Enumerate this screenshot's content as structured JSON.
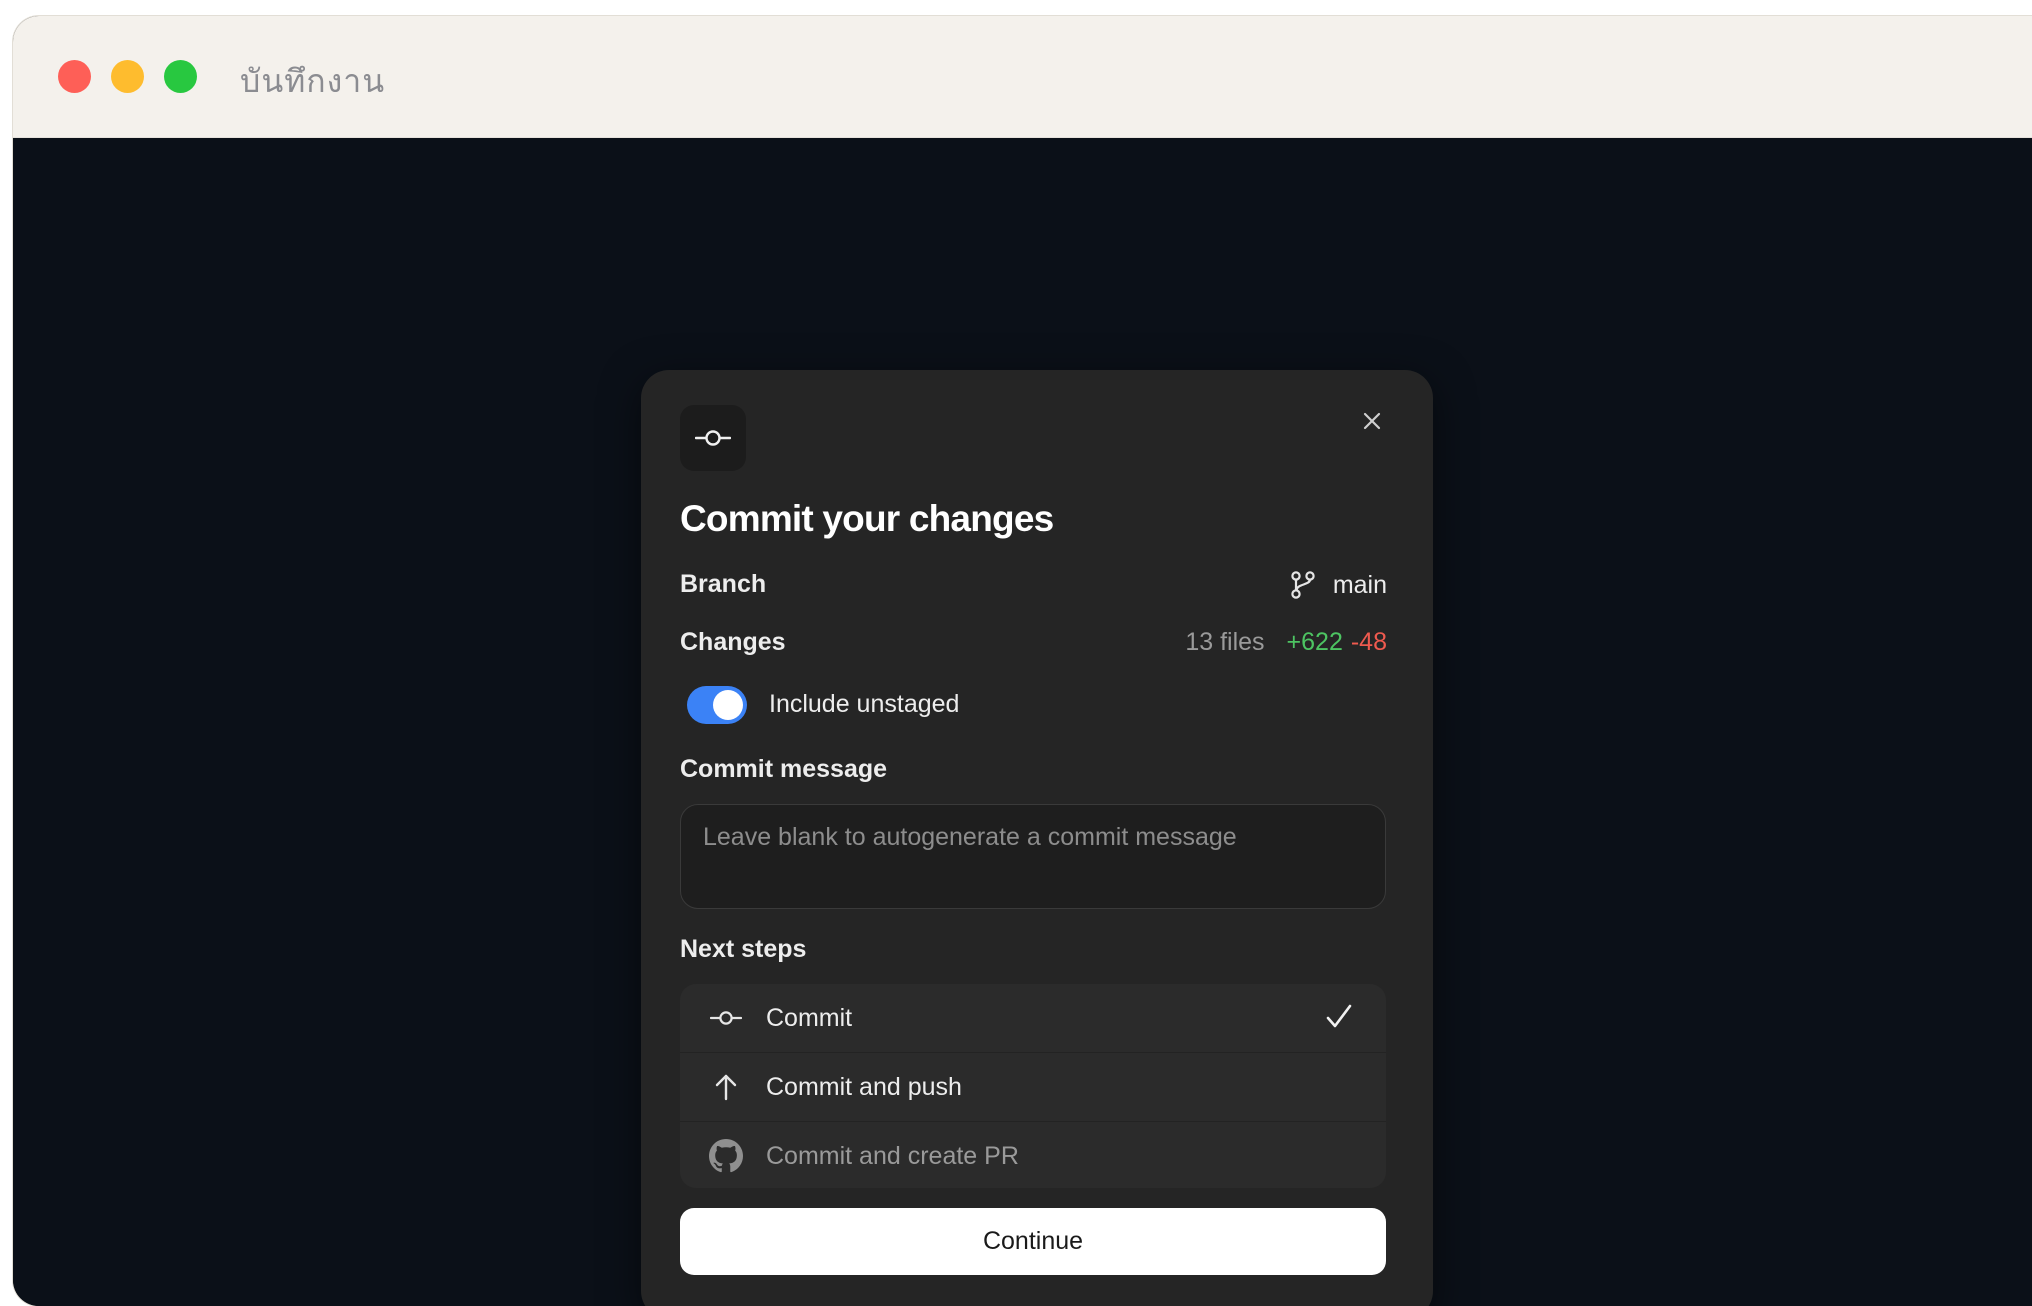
{
  "window": {
    "title": "บันทึกงาน"
  },
  "dialog": {
    "title": "Commit your changes",
    "branch": {
      "label": "Branch",
      "value": "main"
    },
    "changes": {
      "label": "Changes",
      "files": "13 files",
      "additions": "+622",
      "deletions": "-48"
    },
    "include_unstaged": {
      "label": "Include unstaged",
      "enabled": true
    },
    "commit_message": {
      "label": "Commit message",
      "value": "",
      "placeholder": "Leave blank to autogenerate a commit message"
    },
    "next_steps": {
      "label": "Next steps",
      "options": [
        {
          "label": "Commit",
          "icon": "commit-icon",
          "selected": true
        },
        {
          "label": "Commit and push",
          "icon": "arrow-up-icon",
          "selected": false
        },
        {
          "label": "Commit and create PR",
          "icon": "github-icon",
          "selected": false,
          "disabled": true
        }
      ]
    },
    "continue_label": "Continue"
  },
  "colors": {
    "accent": "#3b82f6",
    "additions": "#4dc462",
    "deletions": "#ef5a4f",
    "dialog_bg": "#252525",
    "backdrop": "#0b1018"
  }
}
